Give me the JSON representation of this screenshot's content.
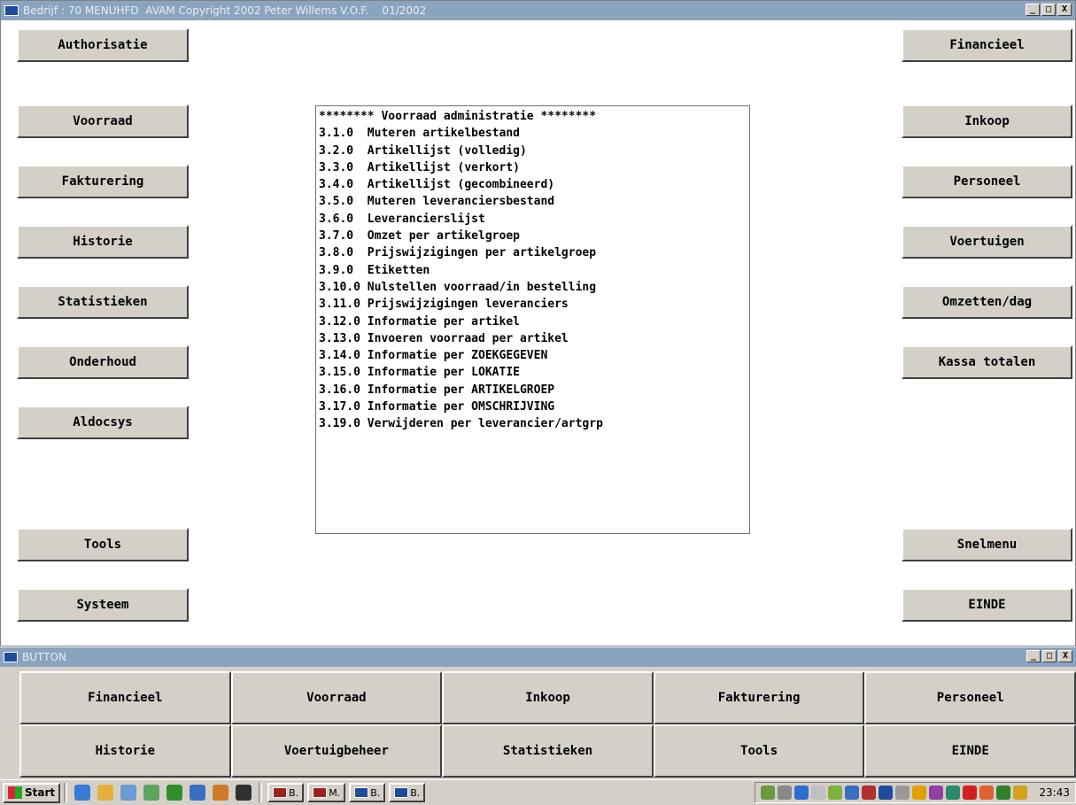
{
  "main_window": {
    "title": "Bedrijf : 70 MENUHFD  AVAM Copyright 2002 Peter Willems V.O.F.    01/2002",
    "controls": [
      "_",
      "□",
      "X"
    ],
    "left_buttons": [
      "Authorisatie",
      "Voorraad",
      "Fakturering",
      "Historie",
      "Statistieken",
      "Onderhoud",
      "Aldocsys",
      "Tools",
      "Systeem"
    ],
    "right_buttons": [
      "Financieel",
      "Inkoop",
      "Personeel",
      "Voertuigen",
      "Omzetten/dag",
      "Kassa totalen",
      "Snelmenu",
      "EINDE"
    ],
    "menu_items": [
      "******** Voorraad administratie ********",
      "3.1.0  Muteren artikelbestand",
      "3.2.0  Artikellijst (volledig)",
      "3.3.0  Artikellijst (verkort)",
      "3.4.0  Artikellijst (gecombineerd)",
      "3.5.0  Muteren leveranciersbestand",
      "3.6.0  Leverancierslijst",
      "3.7.0  Omzet per artikelgroep",
      "3.8.0  Prijswijzigingen per artikelgroep",
      "3.9.0  Etiketten",
      "3.10.0 Nulstellen voorraad/in bestelling",
      "3.11.0 Prijswijzigingen leveranciers",
      "3.12.0 Informatie per artikel",
      "3.13.0 Invoeren voorraad per artikel",
      "3.14.0 Informatie per ZOEKGEGEVEN",
      "3.15.0 Informatie per LOKATIE",
      "3.16.0 Informatie per ARTIKELGROEP",
      "3.17.0 Informatie per OMSCHRIJVING",
      "3.19.0 Verwijderen per leverancier/artgrp"
    ]
  },
  "button_window": {
    "title": "BUTTON",
    "controls": [
      "_",
      "□",
      "X"
    ],
    "row1": [
      "Financieel",
      "Voorraad",
      "Inkoop",
      "Fakturering",
      "Personeel"
    ],
    "row2": [
      "Historie",
      "Voertuigbeheer",
      "Statistieken",
      "Tools",
      "EINDE"
    ]
  },
  "taskbar": {
    "start_label": "Start",
    "tasks": [
      "B.",
      "M.",
      "B.",
      "B."
    ],
    "clock": "23:43"
  }
}
